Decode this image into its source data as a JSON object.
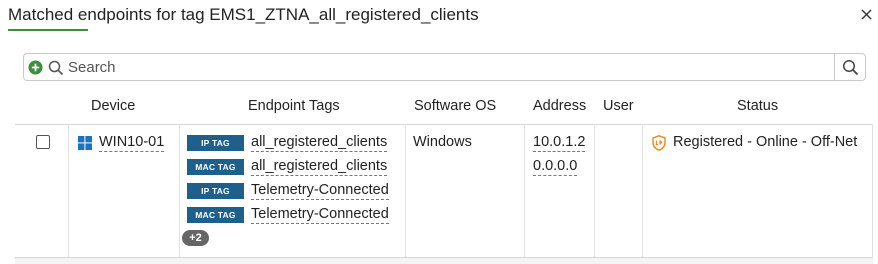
{
  "dialog": {
    "title": "Matched endpoints for tag EMS1_ZTNA_all_registered_clients",
    "close_icon": "close-icon"
  },
  "search": {
    "placeholder": "Search",
    "value": "",
    "add_icon": "plus-circle-icon",
    "search_icon": "search-icon"
  },
  "table": {
    "columns": [
      "Device",
      "Endpoint Tags",
      "Software OS",
      "Address",
      "User",
      "Status"
    ],
    "rows": [
      {
        "checked": false,
        "device_icon": "windows-icon",
        "device": "WIN10-01",
        "tags": [
          {
            "type": "IP TAG",
            "name": "all_registered_clients"
          },
          {
            "type": "MAC TAG",
            "name": "all_registered_clients"
          },
          {
            "type": "IP TAG",
            "name": "Telemetry-Connected"
          },
          {
            "type": "MAC TAG",
            "name": "Telemetry-Connected"
          }
        ],
        "more_tags": "+2",
        "software_os": "Windows",
        "addresses": [
          "10.0.1.2",
          "0.0.0.0"
        ],
        "user": "",
        "status_icon": "shield-icon",
        "status": "Registered - Online - Off-Net"
      }
    ]
  },
  "colors": {
    "accent_green": "#3d8f3d",
    "tag_badge_blue": "#1f5f8b",
    "status_orange": "#e8891c",
    "windows_blue": "#1e73be"
  }
}
